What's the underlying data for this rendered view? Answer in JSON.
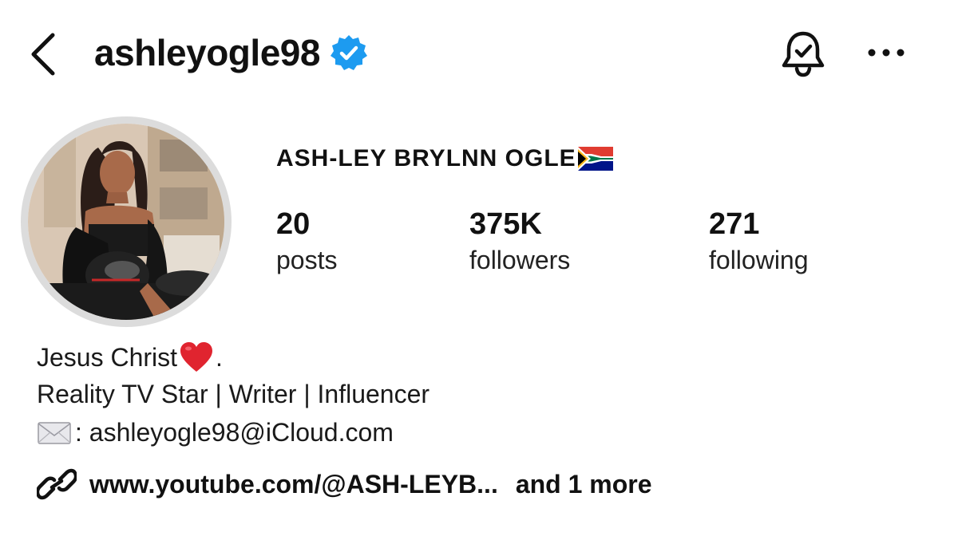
{
  "header": {
    "username": "ashleyogle98",
    "verified": true,
    "icons": [
      "back-chevron-icon",
      "verified-badge-icon",
      "notification-bell-icon",
      "more-options-icon"
    ],
    "accent_color": "#1d9bf0"
  },
  "profile": {
    "full_name": "ASH-LEY BRYLNN OGLE",
    "flag_icon": "south-africa-flag-icon",
    "stats": [
      {
        "value": "20",
        "label": "posts"
      },
      {
        "value": "375K",
        "label": "followers"
      },
      {
        "value": "271",
        "label": "following"
      }
    ]
  },
  "bio": {
    "line1_text": "Jesus Christ",
    "line1_suffix": ".",
    "line1_icon": "red-heart-icon",
    "line2": "Reality TV Star | Writer | Influencer",
    "line3_icon": "envelope-icon",
    "line3_text": ": ashleyogle98@iCloud.com"
  },
  "links": {
    "icon": "link-icon",
    "url_text": "www.youtube.com/@ASH-LEYB...",
    "more_text": "and 1 more"
  }
}
